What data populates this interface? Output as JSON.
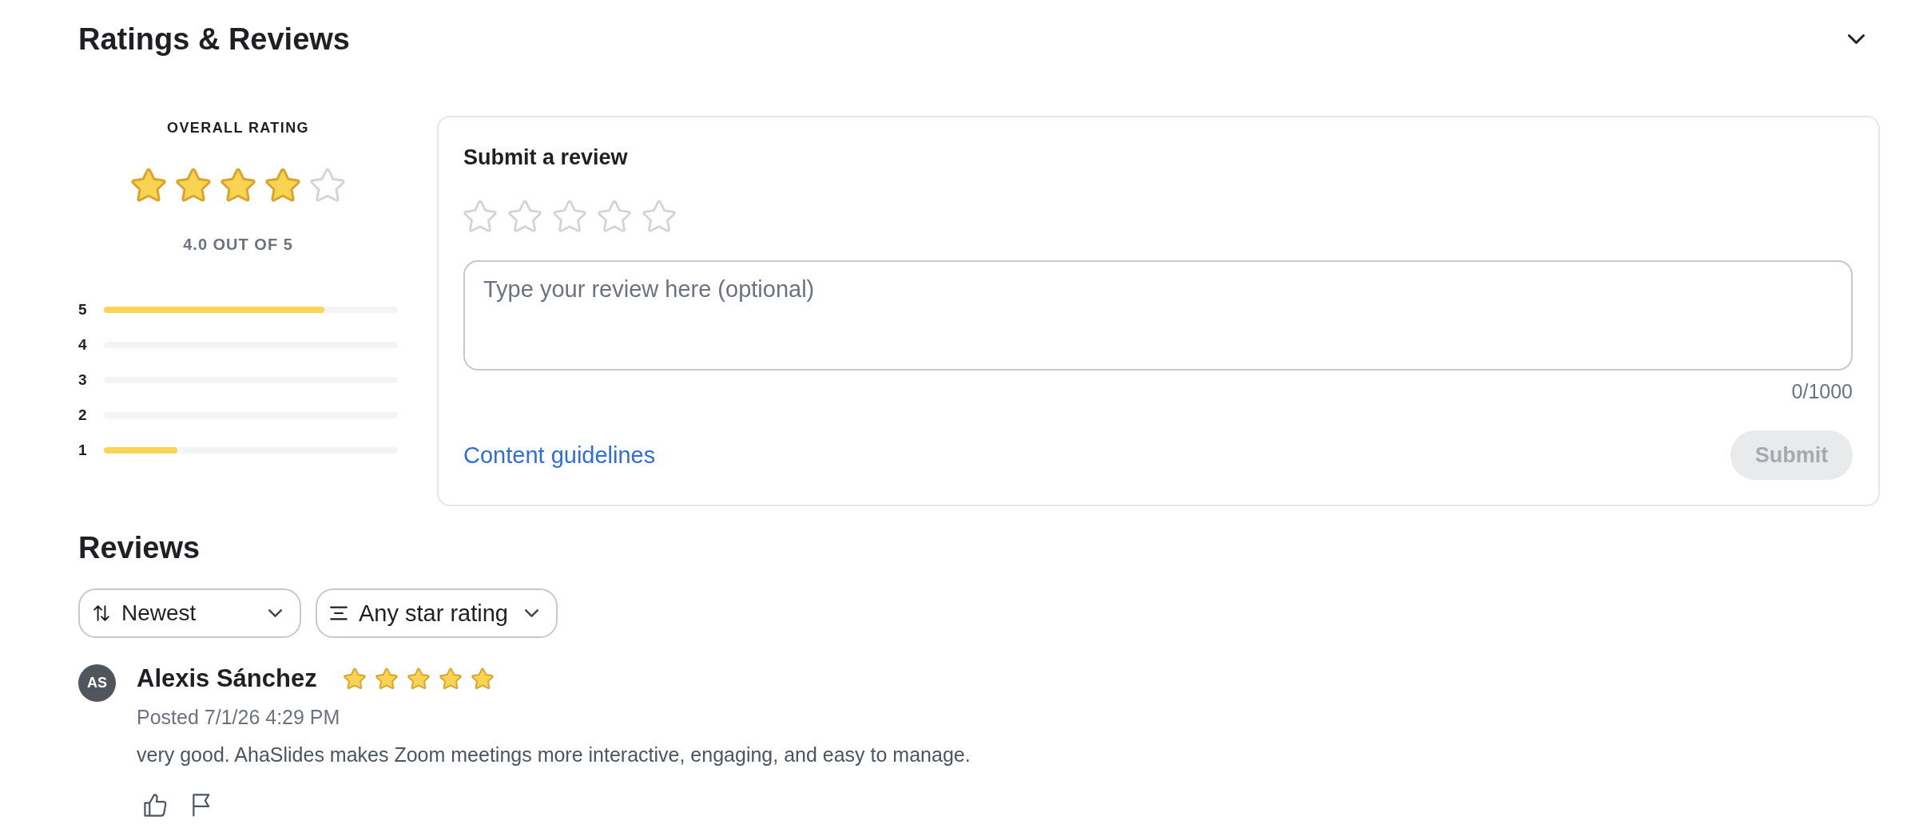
{
  "header": {
    "title": "Ratings & Reviews"
  },
  "summary": {
    "label": "OVERALL RATING",
    "stars": 4,
    "score": "4.0 OUT OF 5",
    "distribution": [
      {
        "label": "5",
        "level": 0.75
      },
      {
        "label": "4"
      },
      {
        "label": "3"
      },
      {
        "label": "2"
      },
      {
        "label": "1",
        "level": 0.25
      }
    ]
  },
  "submit_form": {
    "title": "Submit a review",
    "stars": 0,
    "placeholder": "Type your review here (optional)",
    "counter": "0/1000",
    "link": "Content guidelines",
    "button": {
      "label": "Submit",
      "disabled": true
    }
  },
  "reviews": {
    "title": "Reviews",
    "filters": [
      {
        "kind": "sort",
        "label": "Newest"
      },
      {
        "kind": "filter",
        "label": "Any star rating"
      }
    ],
    "items": [
      {
        "initials": "AS",
        "name": "Alexis Sánchez",
        "stars": 5,
        "posted": "Posted 7/1/26 4:29 PM",
        "text": "very good. AhaSlides makes Zoom meetings more interactive, engaging, and easy to manage."
      }
    ]
  }
}
